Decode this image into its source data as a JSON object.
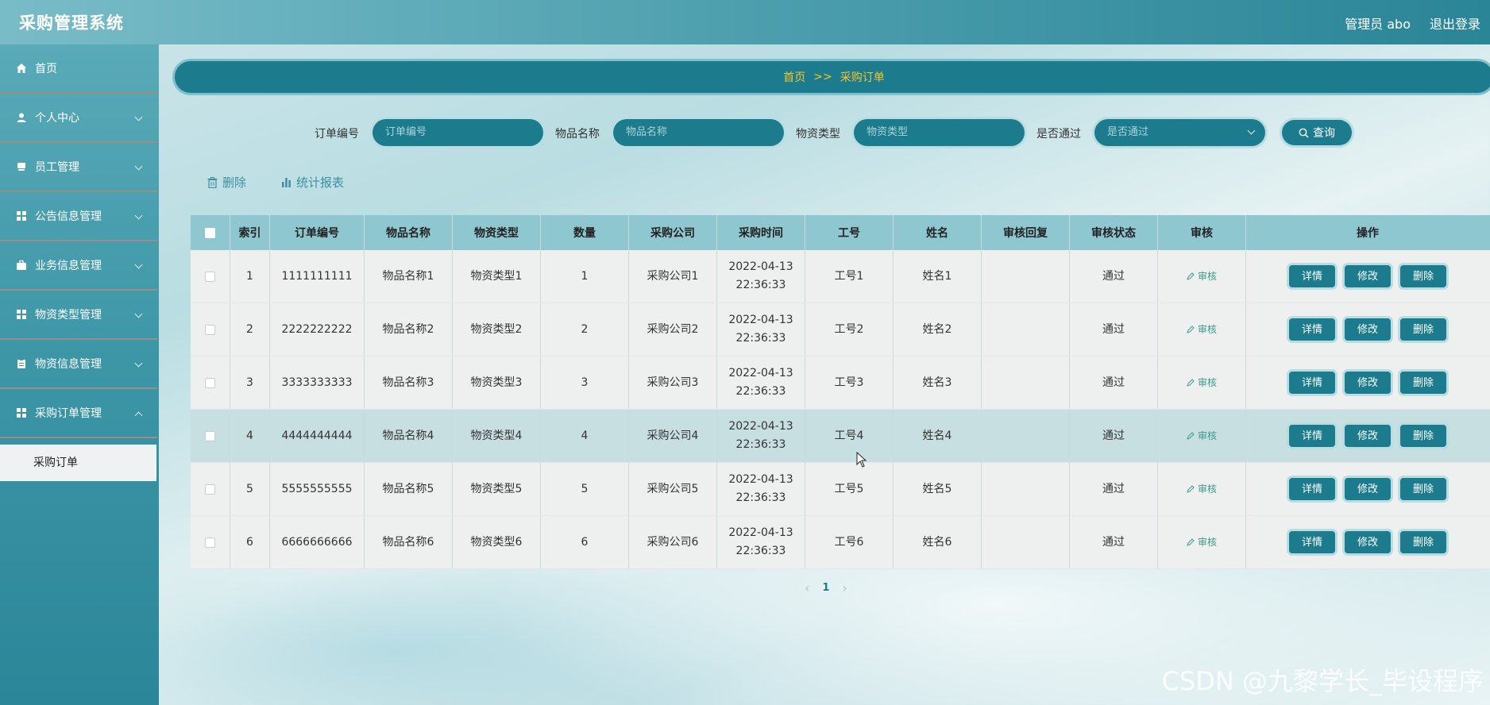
{
  "header": {
    "title": "采购管理系统",
    "user": "管理员 abo",
    "logout": "退出登录"
  },
  "sidebar": {
    "items": [
      {
        "label": "首页",
        "icon": "home-icon"
      },
      {
        "label": "个人中心",
        "icon": "user-icon"
      },
      {
        "label": "员工管理",
        "icon": "employee-icon"
      },
      {
        "label": "公告信息管理",
        "icon": "grid-icon"
      },
      {
        "label": "业务信息管理",
        "icon": "briefcase-icon"
      },
      {
        "label": "物资类型管理",
        "icon": "grid-icon"
      },
      {
        "label": "物资信息管理",
        "icon": "clipboard-icon"
      },
      {
        "label": "采购订单管理",
        "icon": "grid-icon"
      }
    ],
    "sub_item": "采购订单"
  },
  "breadcrumb": {
    "home": "首页",
    "sep": ">>",
    "current": "采购订单"
  },
  "search": {
    "order_no_label": "订单编号",
    "order_no_placeholder": "订单编号",
    "item_name_label": "物品名称",
    "item_name_placeholder": "物品名称",
    "material_type_label": "物资类型",
    "material_type_placeholder": "物资类型",
    "passed_label": "是否通过",
    "passed_placeholder": "是否通过",
    "query_button": "查询"
  },
  "toolbar": {
    "delete": "删除",
    "report": "统计报表"
  },
  "table": {
    "headers": [
      "索引",
      "订单编号",
      "物品名称",
      "物资类型",
      "数量",
      "采购公司",
      "采购时间",
      "工号",
      "姓名",
      "审核回复",
      "审核状态",
      "审核",
      "操作"
    ],
    "rows": [
      {
        "index": "1",
        "order_no": "1111111111",
        "item_name": "物品名称1",
        "material_type": "物资类型1",
        "qty": "1",
        "company": "采购公司1",
        "date": "2022-04-13",
        "time": "22:36:33",
        "emp_no": "工号1",
        "name": "姓名1",
        "reply": "",
        "status": "通过",
        "audit": "审核"
      },
      {
        "index": "2",
        "order_no": "2222222222",
        "item_name": "物品名称2",
        "material_type": "物资类型2",
        "qty": "2",
        "company": "采购公司2",
        "date": "2022-04-13",
        "time": "22:36:33",
        "emp_no": "工号2",
        "name": "姓名2",
        "reply": "",
        "status": "通过",
        "audit": "审核"
      },
      {
        "index": "3",
        "order_no": "3333333333",
        "item_name": "物品名称3",
        "material_type": "物资类型3",
        "qty": "3",
        "company": "采购公司3",
        "date": "2022-04-13",
        "time": "22:36:33",
        "emp_no": "工号3",
        "name": "姓名3",
        "reply": "",
        "status": "通过",
        "audit": "审核"
      },
      {
        "index": "4",
        "order_no": "4444444444",
        "item_name": "物品名称4",
        "material_type": "物资类型4",
        "qty": "4",
        "company": "采购公司4",
        "date": "2022-04-13",
        "time": "22:36:33",
        "emp_no": "工号4",
        "name": "姓名4",
        "reply": "",
        "status": "通过",
        "audit": "审核"
      },
      {
        "index": "5",
        "order_no": "5555555555",
        "item_name": "物品名称5",
        "material_type": "物资类型5",
        "qty": "5",
        "company": "采购公司5",
        "date": "2022-04-13",
        "time": "22:36:33",
        "emp_no": "工号5",
        "name": "姓名5",
        "reply": "",
        "status": "通过",
        "audit": "审核"
      },
      {
        "index": "6",
        "order_no": "6666666666",
        "item_name": "物品名称6",
        "material_type": "物资类型6",
        "qty": "6",
        "company": "采购公司6",
        "date": "2022-04-13",
        "time": "22:36:33",
        "emp_no": "工号6",
        "name": "姓名6",
        "reply": "",
        "status": "通过",
        "audit": "审核"
      }
    ],
    "op_detail": "详情",
    "op_edit": "修改",
    "op_delete": "删除"
  },
  "pagination": {
    "prev": "‹",
    "current": "1",
    "next": "›"
  },
  "watermark": "CSDN @九黎学长_毕设程序",
  "colors": {
    "accent": "#1c7c8d",
    "breadcrumb_text": "#f4c52e",
    "header_row": "#8fc7d1"
  }
}
